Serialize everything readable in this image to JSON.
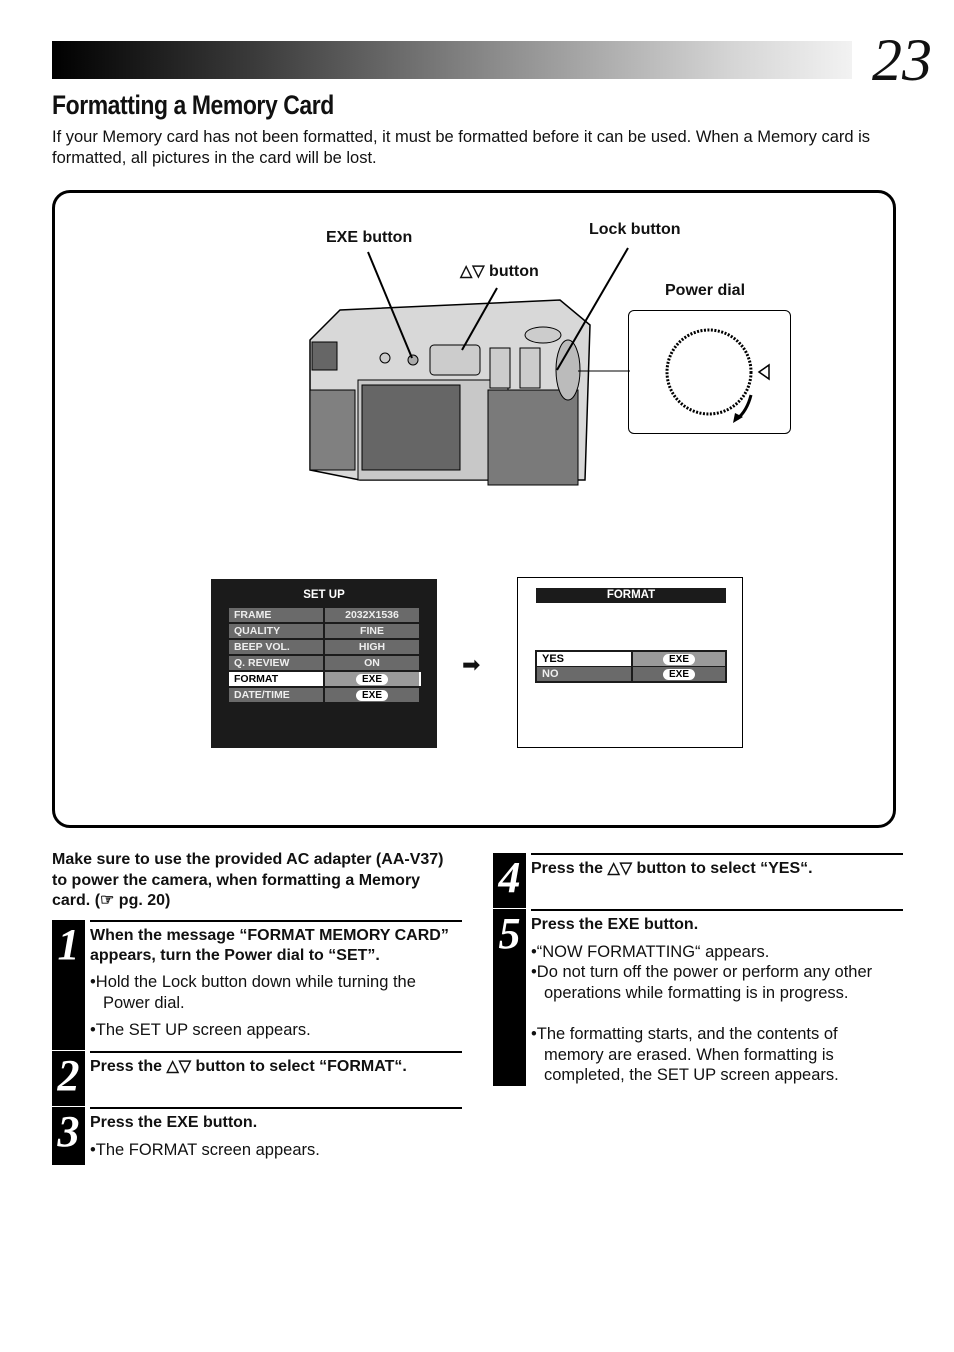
{
  "page": {
    "number": "23",
    "title": "Formatting a Memory Card",
    "intro": "If your Memory card has not been formatted, it must be formatted before it can be used. When a Memory card is formatted, all pictures in the card will be lost."
  },
  "figure": {
    "labels": {
      "exe_button": "EXE button",
      "updown_button": "△▽ button",
      "lock_button": "Lock button",
      "power_dial": "Power dial"
    },
    "setup_screen": {
      "title": "SET UP",
      "rows": [
        {
          "label": "FRAME",
          "value": "2032X1536"
        },
        {
          "label": "QUALITY",
          "value": "FINE"
        },
        {
          "label": "BEEP VOL.",
          "value": "HIGH"
        },
        {
          "label": "Q. REVIEW",
          "value": "ON"
        },
        {
          "label": "FORMAT",
          "value": "EXE",
          "selected": true
        },
        {
          "label": "DATE/TIME",
          "value": "EXE"
        }
      ]
    },
    "arrow": "➡",
    "format_screen": {
      "title": "FORMAT",
      "rows": [
        {
          "label": "YES",
          "value": "EXE",
          "selected": true
        },
        {
          "label": "NO",
          "value": "EXE"
        }
      ]
    }
  },
  "note": "Make sure to use the provided AC adapter (AA-V37) to power the camera, when formatting a Memory card. (☞ pg. 20)",
  "steps": [
    {
      "num": "1",
      "head": "When the message “FORMAT MEMORY CARD” appears, turn the Power dial to “SET”.",
      "bullets": [
        "•Hold the Lock button down while turning the Power dial.",
        "•The SET UP screen appears."
      ]
    },
    {
      "num": "2",
      "head": "Press the △▽ button to select “FORMAT“.",
      "bullets": []
    },
    {
      "num": "3",
      "head": "Press the EXE button.",
      "bullets": [
        "•The FORMAT screen appears."
      ]
    },
    {
      "num": "4",
      "head": "Press the △▽ button to select “YES“.",
      "bullets": []
    },
    {
      "num": "5",
      "head": "Press the EXE button.",
      "bullets": [
        "•“NOW FORMATTING“ appears.",
        "•Do not turn off the power or perform any other operations while formatting is in progress.",
        "•The formatting starts, and the contents of memory are erased. When formatting is completed, the SET UP screen appears."
      ]
    }
  ]
}
